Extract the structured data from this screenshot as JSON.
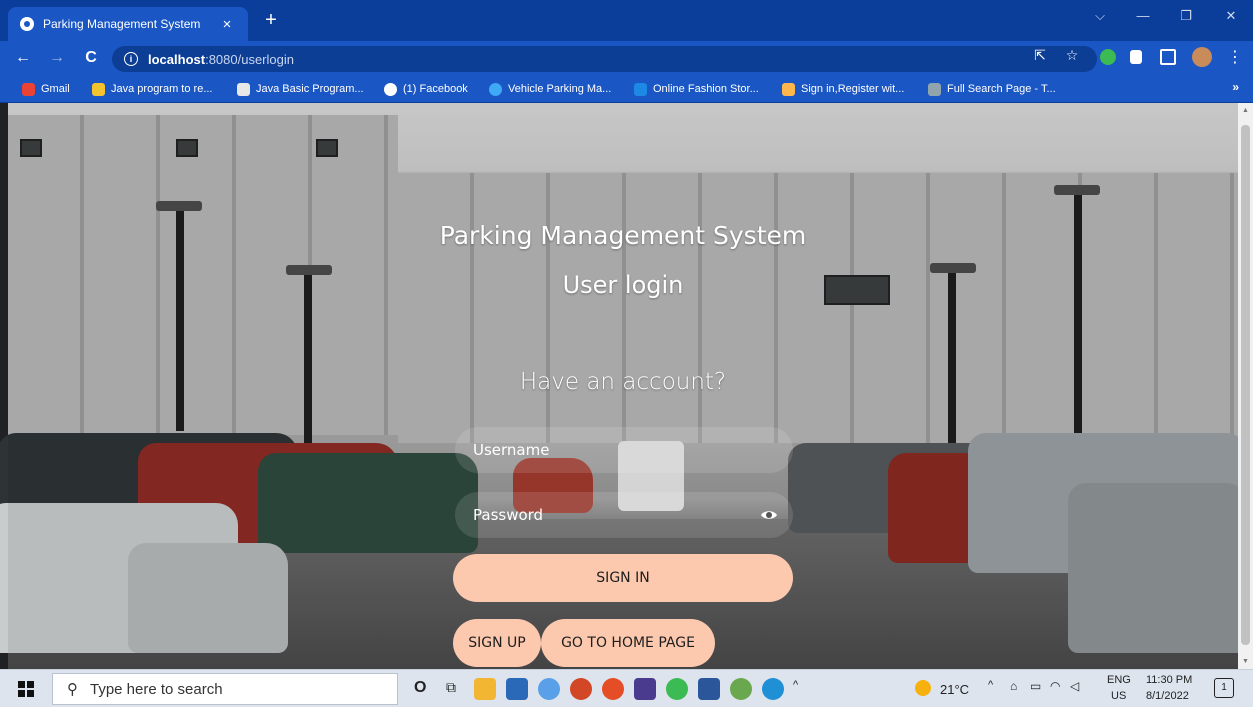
{
  "window": {
    "tab_title": "Parking Management System",
    "tab_close": "×",
    "new_tab": "+",
    "minimize": "—",
    "restore": "❐",
    "close": "✕",
    "tabs_menu": "⌵"
  },
  "toolbar": {
    "back": "←",
    "forward": "→",
    "reload": "C",
    "url_host": "localhost",
    "url_rest": ":8080/userlogin",
    "share": "⇱",
    "star": "☆",
    "menu": "⋮"
  },
  "bookmarks": {
    "items": [
      {
        "label": "Gmail",
        "color": "#ea4335"
      },
      {
        "label": "Java program to re...",
        "color": "#f4c430"
      },
      {
        "label": "Java Basic Program...",
        "color": "#e8e8e8"
      },
      {
        "label": "(1) Facebook",
        "color": "#ffffff"
      },
      {
        "label": "Vehicle Parking Ma...",
        "color": "#3fa9f5"
      },
      {
        "label": "Online Fashion Stor...",
        "color": "#1e88e5"
      },
      {
        "label": "Sign in,Register wit...",
        "color": "#ffb74d"
      },
      {
        "label": "Full Search Page - T...",
        "color": "#90a4ae"
      }
    ],
    "more": "»"
  },
  "login": {
    "title": "Parking Management System",
    "heading": "User login",
    "subtitle": "Have an account?",
    "username_placeholder": "Username",
    "password_placeholder": "Password",
    "sign_in": "SIGN IN",
    "sign_up": "SIGN UP",
    "home": "GO TO HOME PAGE",
    "accent_color": "#fcc8ae"
  },
  "taskbar": {
    "search_placeholder": "Type here to search",
    "cortana": "O",
    "task_view": "⧉",
    "weather": "21°C",
    "chevron": "^",
    "lang_top": "ENG",
    "lang_bottom": "US",
    "time": "11:30 PM",
    "date": "8/1/2022",
    "notifications": "1"
  }
}
